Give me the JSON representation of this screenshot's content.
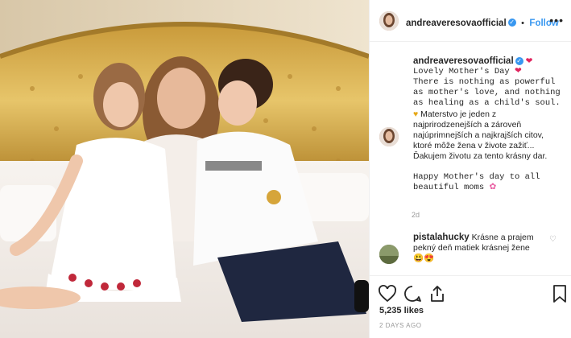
{
  "post": {
    "username": "andreaveresovaofficial",
    "follow_label": "Follow",
    "more_label": "•••",
    "verified_mark": "✓"
  },
  "caption": {
    "username": "andreaveresovaofficial",
    "line1": "Lovely Mother's Day",
    "line2": "There is nothing as powerful as mother's love, and nothing as healing as a child's soul.",
    "line3": "Materstvo je jeden z najprirodzenejších a zároveň najúprimnejších a najkrajších citov, ktoré môže žena v živote zažiť... Ďakujem životu za tento krásny dar.",
    "line4": "Happy Mother's day to all beautiful moms",
    "age": "2d"
  },
  "comment": {
    "username": "pistalahucky",
    "text": "Krásne a prajem pekný deň matiek krásnej žene",
    "emoji": "😃😍"
  },
  "stats": {
    "likes": "5,235 likes",
    "date": "2 DAYS AGO"
  },
  "icons": [
    "heart-icon",
    "comment-icon",
    "share-icon",
    "bookmark-icon",
    "verified-icon",
    "more-icon"
  ],
  "colors": {
    "accent": "#3897f0",
    "heart": "#e0245e",
    "text": "#262626",
    "muted": "#999999"
  }
}
